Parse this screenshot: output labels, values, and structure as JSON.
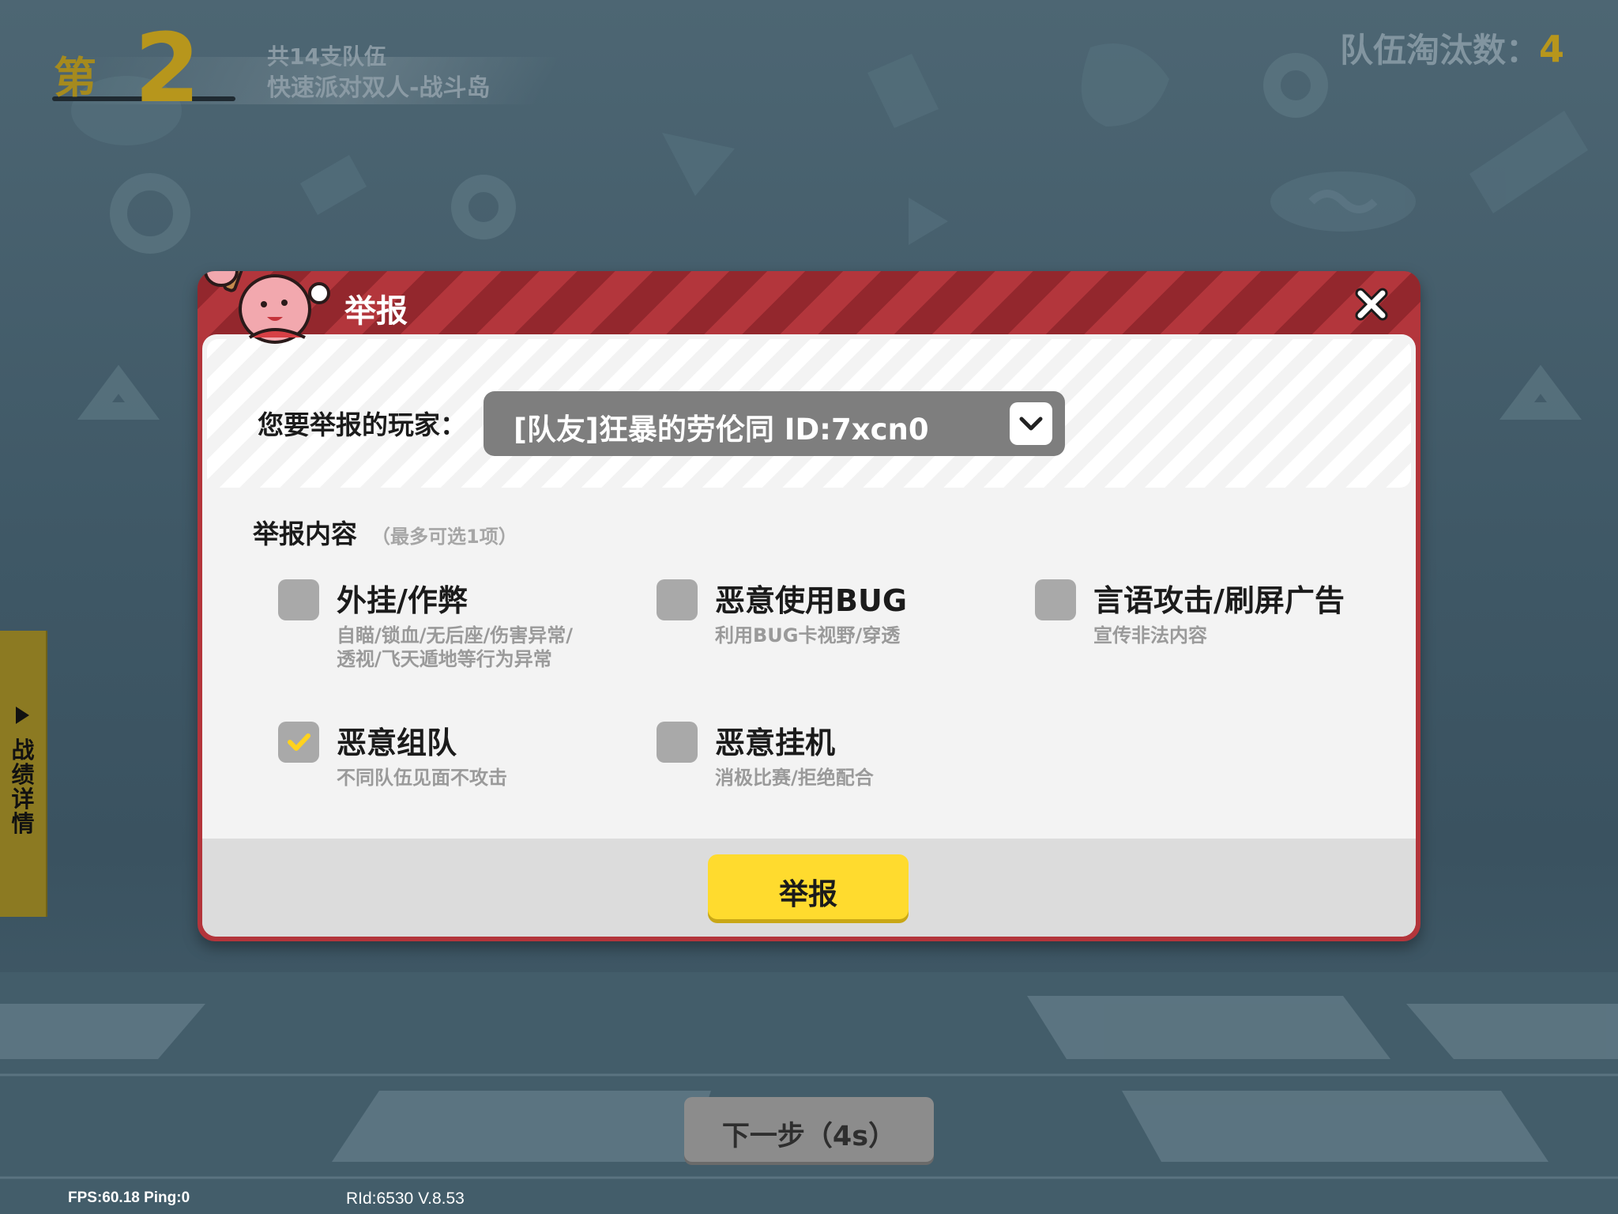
{
  "rank": {
    "prefix": "第",
    "number": "2",
    "team_count": "共14支队伍",
    "mode": "快速派对双人-战斗岛"
  },
  "eliminations": {
    "label": "队伍淘汰数：",
    "count": "4"
  },
  "side_tab": {
    "label": "战绩详情"
  },
  "dialog": {
    "title": "举报",
    "player_label": "您要举报的玩家：",
    "player_value": "[队友]狂暴的劳伦同 ID:7xcn0",
    "content_title": "举报内容",
    "content_hint": "（最多可选1项）",
    "options": [
      {
        "name": "外挂/作弊",
        "desc1": "自瞄/锁血/无后座/伤害异常/",
        "desc2": "透视/飞天遁地等行为异常",
        "checked": false
      },
      {
        "name": "恶意使用BUG",
        "desc1": "利用BUG卡视野/穿透",
        "desc2": "",
        "checked": false
      },
      {
        "name": "言语攻击/刷屏广告",
        "desc1": "宣传非法内容",
        "desc2": "",
        "checked": false
      },
      {
        "name": "恶意组队",
        "desc1": "不同队伍见面不攻击",
        "desc2": "",
        "checked": true
      },
      {
        "name": "恶意挂机",
        "desc1": "消极比赛/拒绝配合",
        "desc2": "",
        "checked": false
      }
    ],
    "submit_label": "举报"
  },
  "next_button": "下一步（4s）",
  "debug": {
    "fps": "FPS:60.18 Ping:0",
    "rid": "RId:6530 V.8.53"
  },
  "colors": {
    "accent_yellow": "#ffdb2e",
    "dialog_red": "#b3353b",
    "rank_gold": "#b7961c"
  }
}
